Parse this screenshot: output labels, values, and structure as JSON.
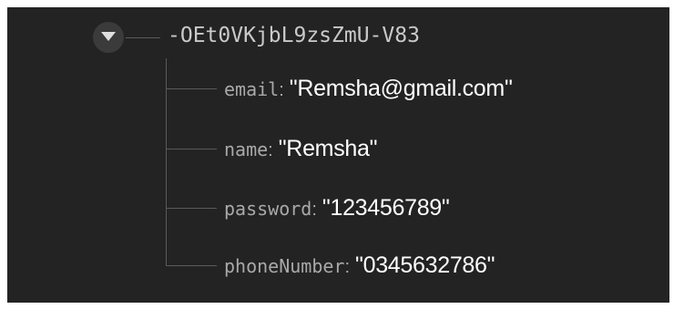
{
  "node": {
    "key": "-OEt0VKjbL9zsZmU-V83",
    "toggle_icon": "caret-down-icon",
    "children": [
      {
        "key": "email",
        "colon": ":",
        "value": "\"Remsha@gmail.com\""
      },
      {
        "key": "name",
        "colon": ":",
        "value": "\"Remsha\""
      },
      {
        "key": "password",
        "colon": ":",
        "value": "\"123456789\""
      },
      {
        "key": "phoneNumber",
        "colon": ":",
        "value": "\"0345632786\""
      }
    ]
  },
  "colors": {
    "background": "#232323",
    "tree_line": "#5a5a5a",
    "key_text": "#a9a9a9",
    "value_text": "#ffffff"
  }
}
